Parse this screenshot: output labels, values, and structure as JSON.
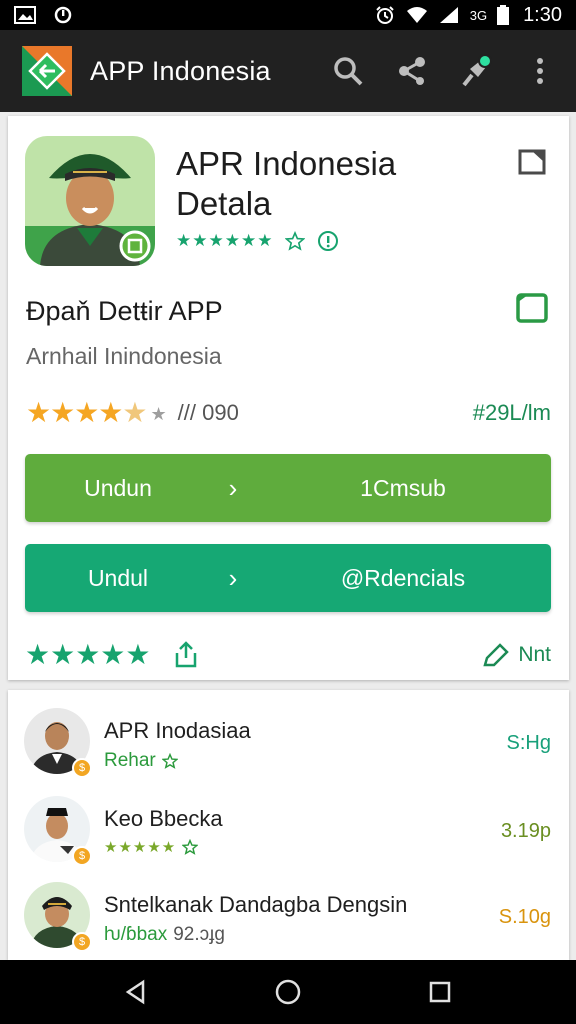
{
  "status_bar": {
    "carrier": "3G",
    "time": "1:30"
  },
  "app_bar": {
    "title": "APP Indonesia"
  },
  "detail": {
    "title": "APR Indonesia Detala",
    "subtitle": "Ðpaň Detŧir APP",
    "developer": "Arnhail Inindonesia",
    "review_count": "/// 090",
    "size": "#29L/lm",
    "more_label": "Nnt"
  },
  "buttons": [
    {
      "left_label": "Undun",
      "right_label": "1Cmsub",
      "color": "#5fac3d"
    },
    {
      "left_label": "Undul",
      "right_label": "@Rdencials",
      "color": "#16a874"
    }
  ],
  "list": [
    {
      "name": "APR Inodasiaa",
      "meta": "Rehar",
      "price": "S:Hg"
    },
    {
      "name": "Keo Bbecka",
      "meta": "★★★★★",
      "price": "3.19p"
    },
    {
      "name": "Sntelkanak Dandagba Dengsin",
      "meta_green": "ƕ/ɓbax",
      "meta": "92.ɔɟg",
      "price": "S.10g"
    }
  ],
  "colors": {
    "accent_green": "#17a36e",
    "star_gold": "#f5a623",
    "appbar": "#212121"
  }
}
